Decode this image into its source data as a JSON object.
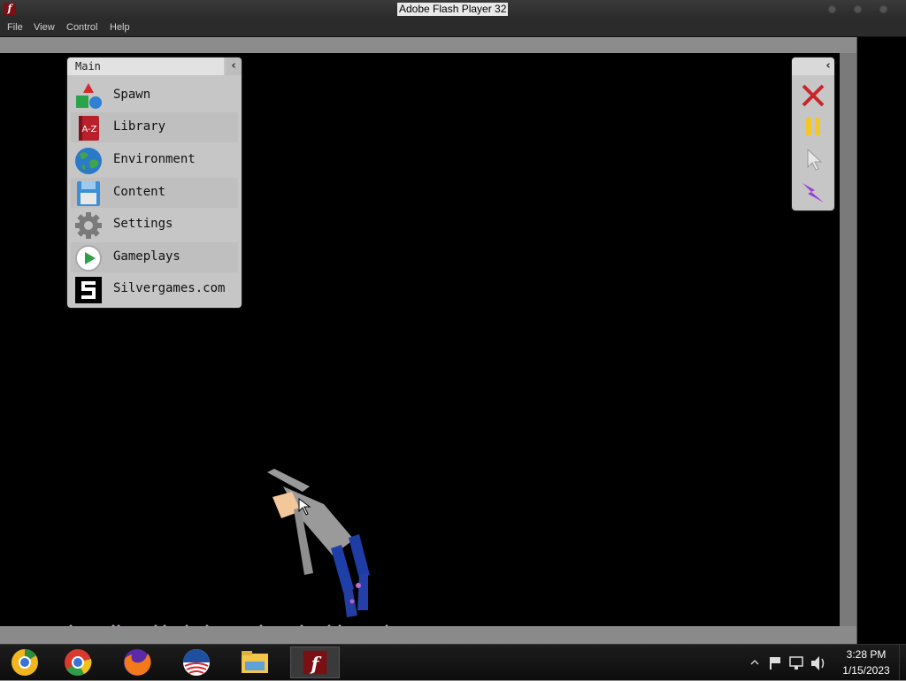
{
  "window": {
    "title": "Adobe Flash Player 32"
  },
  "menubar": [
    "File",
    "View",
    "Control",
    "Help"
  ],
  "main_panel": {
    "title": "Main",
    "collapse_icon": "chevron-left-icon",
    "items": [
      {
        "label": "Spawn",
        "icon": "shapes-icon"
      },
      {
        "label": "Library",
        "icon": "book-a-z-icon"
      },
      {
        "label": "Environment",
        "icon": "globe-icon"
      },
      {
        "label": "Content",
        "icon": "floppy-disk-icon"
      },
      {
        "label": "Settings",
        "icon": "gear-icon"
      },
      {
        "label": "Gameplays",
        "icon": "play-icon"
      },
      {
        "label": "Silvergames.com",
        "icon": "silvergames-logo-icon"
      }
    ]
  },
  "tools_panel": {
    "collapse_icon": "chevron-left-icon",
    "tools": [
      "close-icon",
      "pause-icon",
      "cursor-icon",
      "lightning-icon"
    ]
  },
  "taskbar": {
    "apps": [
      "chrome-canary-icon",
      "chrome-icon",
      "firefox-icon",
      "obama-icon",
      "file-explorer-icon",
      "flash-player-icon"
    ],
    "active_app": "flash-player-icon",
    "tray_icons": [
      "chevron-up-icon",
      "flag-icon",
      "network-icon",
      "volume-icon"
    ],
    "time": "3:28 PM",
    "date": "1/15/2023"
  },
  "colors": {
    "stage": "#000000",
    "panel": "#c6c6c6",
    "taskbar": "#151515",
    "titlebar": "#2e2e2e"
  }
}
